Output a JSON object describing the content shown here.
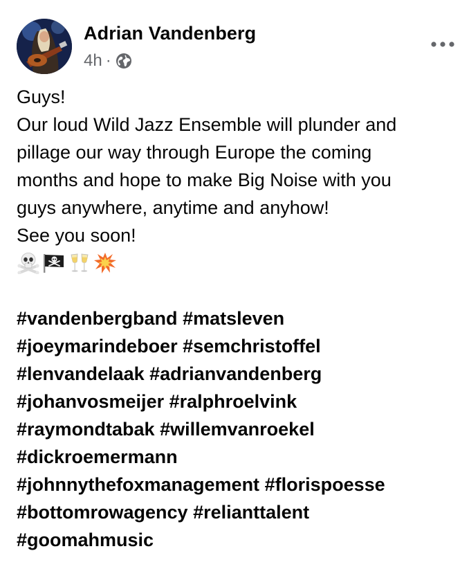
{
  "post": {
    "author": "Adrian Vandenberg",
    "time": "4h",
    "separator": "·",
    "lines": [
      "Guys!",
      "Our loud Wild Jazz Ensemble will plunder and",
      "pillage our way through Europe the coming",
      "months and hope to make Big Noise with you",
      "guys anywhere, anytime and anyhow!",
      "See you soon!"
    ],
    "emojis": [
      "skull-and-crossbones-icon",
      "pirate-flag-icon",
      "clinking-glasses-icon",
      "collision-icon"
    ],
    "hashtag_lines": [
      [
        "#vandenbergband",
        "#matsleven"
      ],
      [
        "#joeymarindeboer",
        "#semchristoffel"
      ],
      [
        "#lenvandelaak",
        "#adrianvandenberg"
      ],
      [
        "#johanvosmeijer",
        "#ralphroelvink"
      ],
      [
        "#raymondtabak",
        "#willemvanroekel"
      ],
      [
        "#dickroemermann"
      ],
      [
        "#johnnythefoxmanagement",
        "#florispoesse"
      ],
      [
        "#bottomrowagency",
        "#relianttalent"
      ],
      [
        "#goomahmusic"
      ]
    ]
  },
  "colors": {
    "text": "#050505",
    "secondary": "#65676b"
  },
  "icons": {
    "privacy": "globe-icon",
    "menu": "more-horizontal-icon"
  }
}
